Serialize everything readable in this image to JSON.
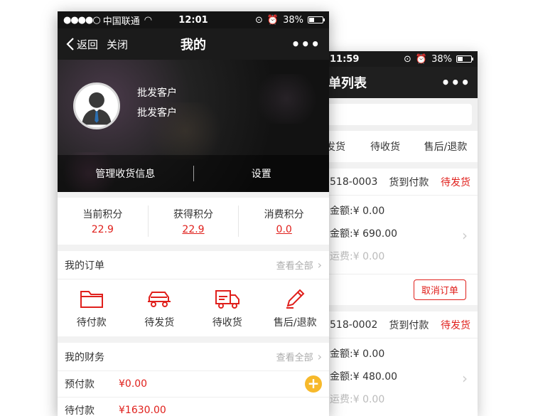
{
  "back_phone": {
    "status": {
      "time": "11:59",
      "battery": "38%"
    },
    "nav": {
      "title": "单列表",
      "more": "•••"
    },
    "tabs": [
      "发货",
      "待收货",
      "售后/退款"
    ],
    "orders": [
      {
        "order_no": "518-0003",
        "payment": "货到付款",
        "status": "待发货",
        "lines": [
          "金额:¥ 0.00",
          "金额:¥ 690.00",
          "运费:¥ 0.00"
        ],
        "button": "取消订单"
      },
      {
        "order_no": "518-0002",
        "payment": "货到付款",
        "status": "待发货",
        "lines": [
          "金额:¥ 0.00",
          "金额:¥ 480.00",
          "运费:¥ 0.00"
        ]
      }
    ]
  },
  "front_phone": {
    "status": {
      "dots": "●●●●○",
      "carrier": "中国联通",
      "time": "12:01",
      "battery": "38%"
    },
    "nav": {
      "back": "返回",
      "close": "关闭",
      "title": "我的",
      "more": "•••"
    },
    "profile": {
      "name": "批发客户",
      "level": "批发客户"
    },
    "actions": {
      "address": "管理收货信息",
      "settings": "设置"
    },
    "points": [
      {
        "label": "当前积分",
        "value": "22.9"
      },
      {
        "label": "获得积分",
        "value": "22.9"
      },
      {
        "label": "消费积分",
        "value": "0.0"
      }
    ],
    "my_orders": {
      "title": "我的订单",
      "view_all": "查看全部",
      "items": [
        {
          "label": "待付款",
          "icon": "folder-icon"
        },
        {
          "label": "待发货",
          "icon": "car-icon"
        },
        {
          "label": "待收货",
          "icon": "truck-icon"
        },
        {
          "label": "售后/退款",
          "icon": "pencil-icon"
        }
      ]
    },
    "finance": {
      "title": "我的财务",
      "view_all": "查看全部",
      "rows": [
        {
          "label": "预付款",
          "amount": "¥0.00"
        },
        {
          "label": "待付款",
          "amount": "¥1630.00"
        }
      ]
    }
  },
  "colors": {
    "accent_red": "#e0201c",
    "plus_yellow": "#f7b92b",
    "nav_dark": "#1b1b1b"
  }
}
